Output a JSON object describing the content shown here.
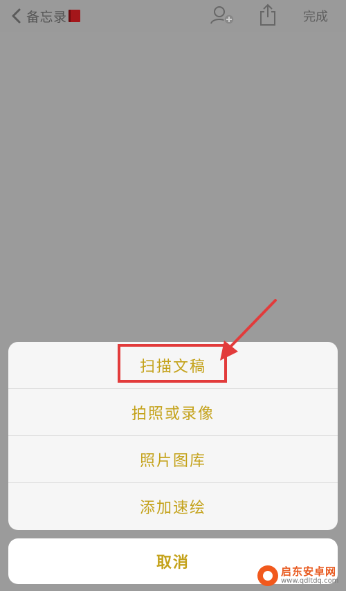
{
  "navbar": {
    "back_label": "备忘录",
    "done_label": "完成"
  },
  "action_sheet": {
    "items": [
      "扫描文稿",
      "拍照或录像",
      "照片图库",
      "添加速绘"
    ],
    "cancel_label": "取消"
  },
  "watermark": {
    "title": "启东安卓网",
    "url": "www.qdltdq.com"
  },
  "colors": {
    "action_text": "#c4a21a",
    "highlight": "#e23b3b",
    "overlay": "#9b9b9b"
  },
  "icons": [
    "chevron-left-icon",
    "notebook-icon",
    "add-person-icon",
    "share-icon"
  ]
}
